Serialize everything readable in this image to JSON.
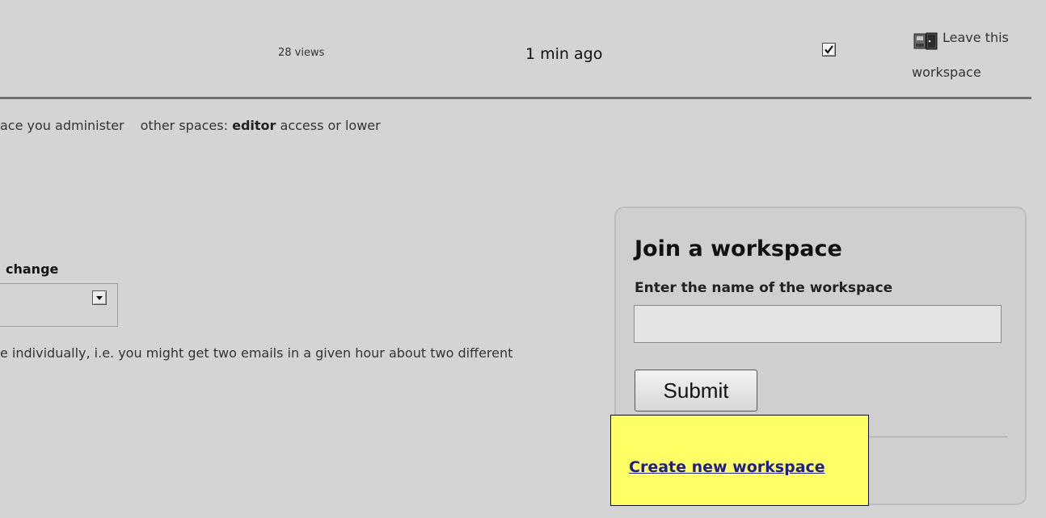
{
  "row": {
    "views": "28 views",
    "time": "1 min ago",
    "leave_line1": "Leave this",
    "leave_line2": "workspace",
    "checked": true,
    "leave_icon": "door-exit-icon"
  },
  "legend": {
    "admin_text": "ace you administer",
    "other_prefix": "other spaces:",
    "other_bold": "editor",
    "other_suffix": "access or lower"
  },
  "notifications": {
    "label": "change",
    "select_value": "",
    "notice": "e individually, i.e. you might get two emails in a given hour about two different"
  },
  "join_panel": {
    "title": "Join a workspace",
    "input_label": "Enter the name of the workspace",
    "input_value": "",
    "submit_label": "Submit"
  },
  "callout": {
    "link_text": "Create new workspace",
    "background": "#ffff66"
  }
}
